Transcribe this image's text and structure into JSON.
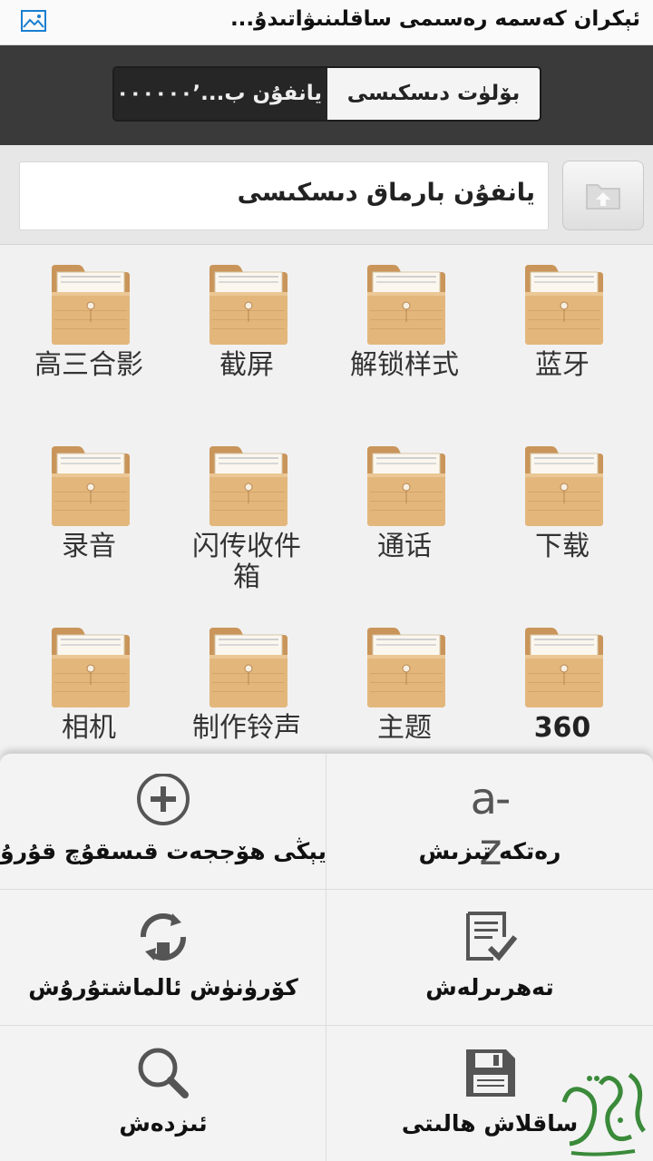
{
  "titlebar": {
    "title": "ئېكران كەسمە رەسىمى ساقلىنىۋاتىدۇ...",
    "icon": "picture-icon"
  },
  "storage": {
    "phone_label": "يانفۇن ب...",
    "phone_value": "٬٠٠٠٠٠٠٬",
    "sdcard_label": "بۆلۈت دىسكىسى"
  },
  "path": {
    "current": "يانفۇن بارماق دىسكىسى",
    "up_icon": "folder-up-icon"
  },
  "folders": [
    {
      "name": "高三合影"
    },
    {
      "name": "截屏"
    },
    {
      "name": "解锁样式"
    },
    {
      "name": "蓝牙"
    },
    {
      "name": "录音"
    },
    {
      "name": "闪传收件箱"
    },
    {
      "name": "通话"
    },
    {
      "name": "下载"
    },
    {
      "name": "相机"
    },
    {
      "name": "制作铃声"
    },
    {
      "name": "主题"
    },
    {
      "name": "360"
    }
  ],
  "menu": {
    "new_folder": "يېڭى ھۆججەت قىسقۇچ قۇرۇش",
    "sort": "رەتكە تىزىش",
    "az_icon_text": "a-z",
    "switch_view": "كۆرۈنۈش ئالماشتۇرۇش",
    "edit": "تەھرىرلەش",
    "search": "ئىزدەش",
    "save_state": "ساقلاش ھالىتى"
  },
  "colors": {
    "folder": "#e0b477",
    "accent_blue": "#1a7fd0",
    "watermark": "#3a8a3a"
  }
}
